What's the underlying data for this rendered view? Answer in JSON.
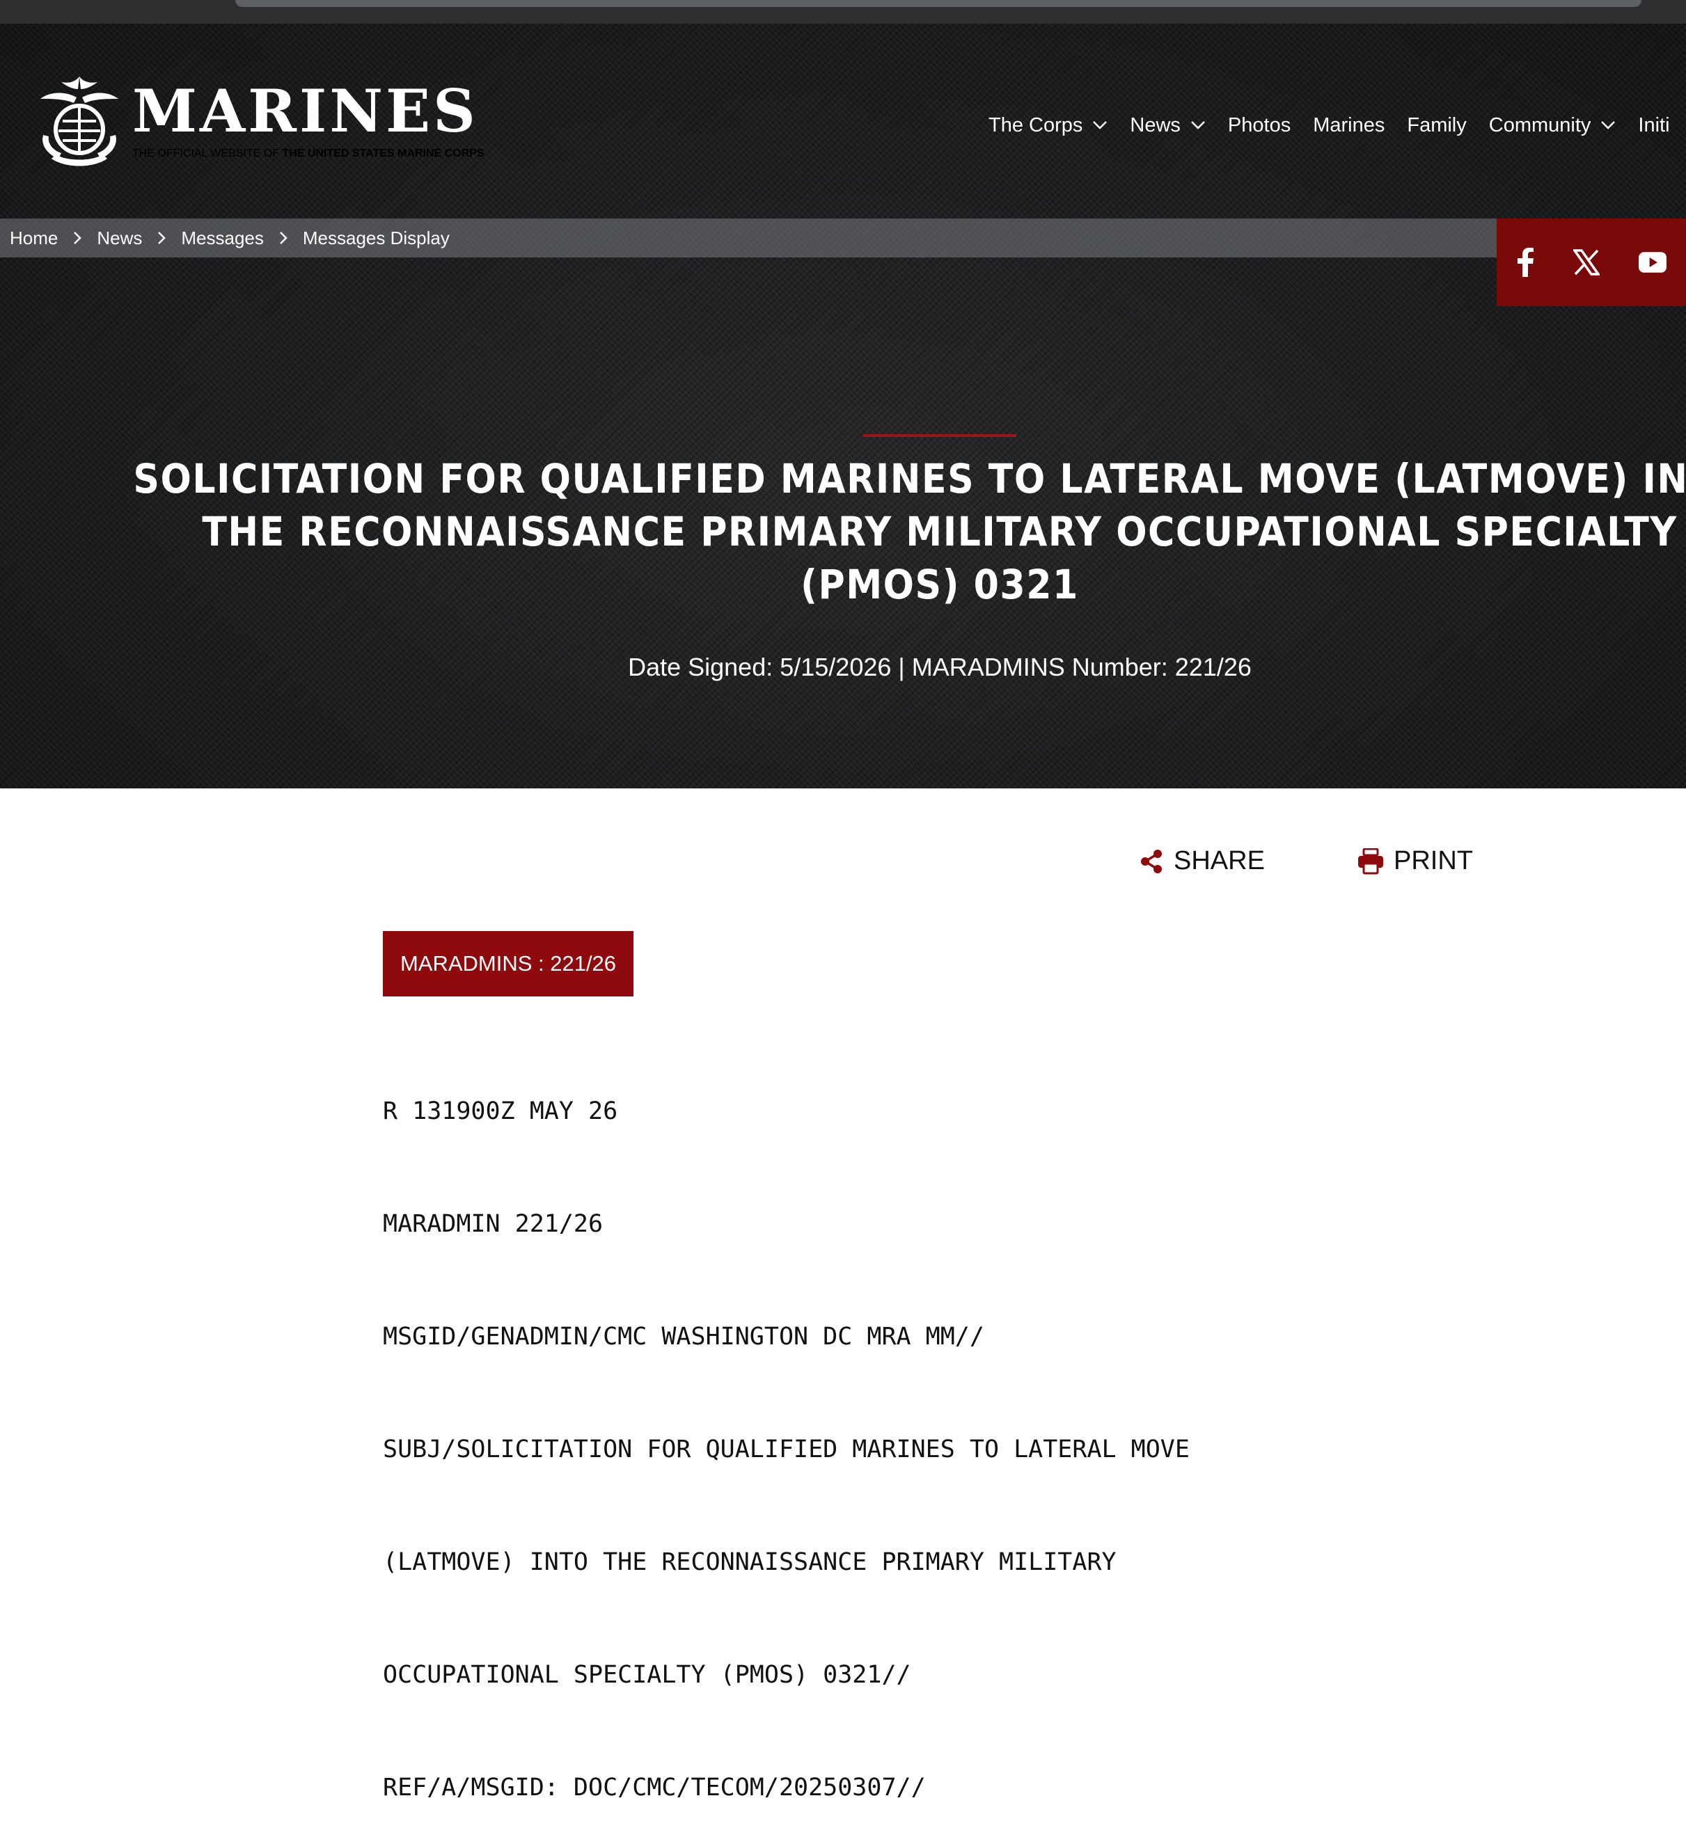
{
  "site": {
    "logo_text": "MARINES",
    "tagline_prefix": "THE OFFICIAL WEBSITE OF ",
    "tagline_strong": "THE UNITED STATES MARINE CORPS"
  },
  "nav": {
    "items": [
      {
        "label": "The Corps",
        "has_dropdown": true
      },
      {
        "label": "News",
        "has_dropdown": true
      },
      {
        "label": "Photos",
        "has_dropdown": false
      },
      {
        "label": "Marines",
        "has_dropdown": false
      },
      {
        "label": "Family",
        "has_dropdown": false
      },
      {
        "label": "Community",
        "has_dropdown": true
      },
      {
        "label": "Initi",
        "has_dropdown": false
      }
    ]
  },
  "breadcrumb": [
    "Home",
    "News",
    "Messages",
    "Messages Display"
  ],
  "social": {
    "icons": [
      "facebook-icon",
      "x-icon",
      "youtube-icon"
    ],
    "bg_color": "#7a0a0a"
  },
  "article": {
    "title_lines": [
      "SOLICITATION FOR QUALIFIED MARINES TO LATERAL MOVE  (LATMOVE) INTO",
      "THE RECONNAISSANCE PRIMARY MILITARY  OCCUPATIONAL SPECIALTY",
      "(PMOS) 0321"
    ],
    "meta": "Date Signed: 5/15/2026 | MARADMINS Number: 221/26"
  },
  "actions": {
    "share_label": "SHARE",
    "print_label": "PRINT",
    "icon_color": "#8e0a0c"
  },
  "badge": {
    "label": "MARADMINS : 221/26",
    "color": "#8e0a0c"
  },
  "message_lines": [
    "R 131900Z MAY 26",
    "MARADMIN 221/26",
    "MSGID/GENADMIN/CMC WASHINGTON DC MRA MM//",
    "SUBJ/SOLICITATION FOR QUALIFIED MARINES TO LATERAL MOVE",
    "(LATMOVE) INTO THE RECONNAISSANCE PRIMARY MILITARY",
    "OCCUPATIONAL SPECIALTY (PMOS) 0321//",
    "REF/A/MSGID: DOC/CMC/TECOM/20250307//"
  ]
}
